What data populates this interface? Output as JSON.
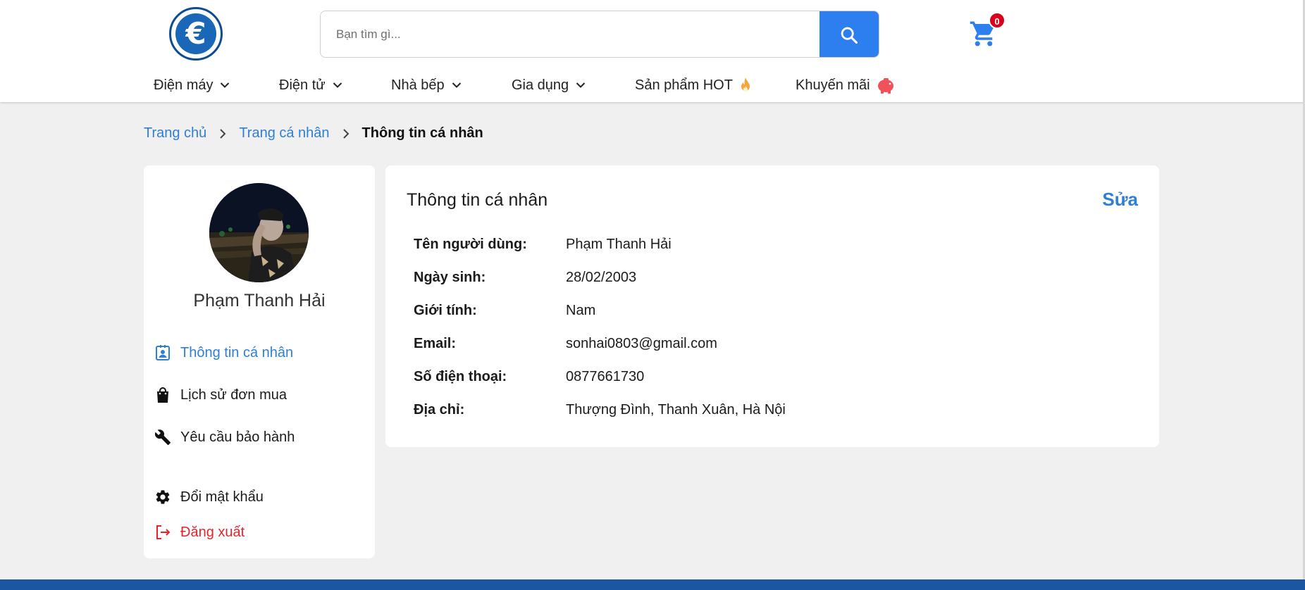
{
  "header": {
    "search": {
      "placeholder": "Bạn tìm gì..."
    },
    "cart": {
      "count": "0"
    },
    "nav": [
      {
        "label": "Điện máy",
        "icon": "chevron-down-icon"
      },
      {
        "label": "Điện tử",
        "icon": "chevron-down-icon"
      },
      {
        "label": "Nhà bếp",
        "icon": "chevron-down-icon"
      },
      {
        "label": "Gia dụng",
        "icon": "chevron-down-icon"
      },
      {
        "label": "Sản phẩm HOT",
        "icon": "fire-icon"
      },
      {
        "label": "Khuyến mãi",
        "icon": "piggy-bank-icon"
      }
    ]
  },
  "breadcrumb": {
    "home": "Trang chủ",
    "profile": "Trang cá nhân",
    "current": "Thông tin cá nhân"
  },
  "sidebar": {
    "name": "Phạm Thanh Hải",
    "items": [
      {
        "label": "Thông tin cá nhân",
        "icon": "contact-card-icon",
        "active": true
      },
      {
        "label": "Lịch sử đơn mua",
        "icon": "shopping-bag-icon"
      },
      {
        "label": "Yêu cầu bảo hành",
        "icon": "wrench-icon"
      },
      {
        "label": "Đổi mật khẩu",
        "icon": "gear-icon"
      },
      {
        "label": "Đăng xuất",
        "icon": "logout-icon"
      }
    ]
  },
  "profile": {
    "title": "Thông tin cá nhân",
    "edit_label": "Sửa",
    "fields": [
      {
        "label": "Tên người dùng:",
        "value": "Phạm Thanh Hải"
      },
      {
        "label": "Ngày sinh:",
        "value": "28/02/2003"
      },
      {
        "label": "Giới tính:",
        "value": "Nam"
      },
      {
        "label": "Email:",
        "value": "sonhai0803@gmail.com"
      },
      {
        "label": "Số điện thoại:",
        "value": "0877661730"
      },
      {
        "label": "Địa chỉ:",
        "value": "Thượng Đình, Thanh Xuân, Hà Nội"
      }
    ]
  },
  "colors": {
    "accent": "#2f7fd6",
    "search_button": "#2d7ff0",
    "logout": "#e8232d",
    "badge": "#d7001e",
    "footer": "#1b56a3",
    "background": "#f0f0f0"
  }
}
